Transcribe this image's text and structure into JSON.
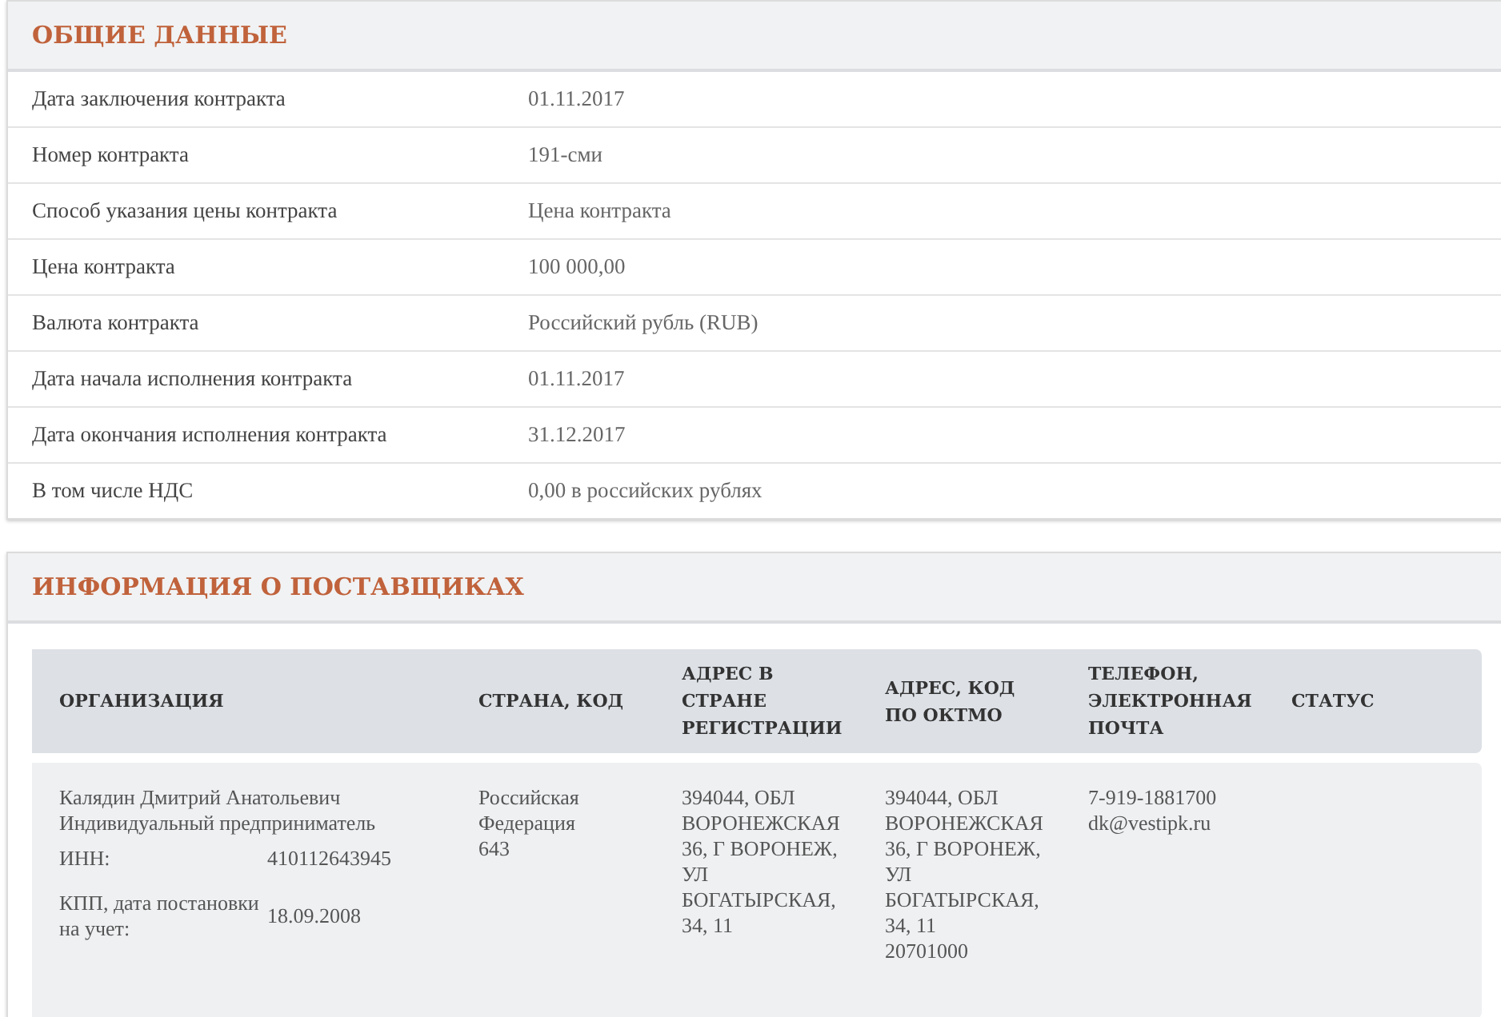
{
  "general": {
    "title": "ОБЩИЕ ДАННЫЕ",
    "rows": [
      {
        "label": "Дата заключения контракта",
        "value": "01.11.2017"
      },
      {
        "label": "Номер контракта",
        "value": "191-сми"
      },
      {
        "label": "Способ указания цены контракта",
        "value": "Цена контракта"
      },
      {
        "label": "Цена контракта",
        "value": "100 000,00"
      },
      {
        "label": "Валюта контракта",
        "value": "Российский рубль (RUB)"
      },
      {
        "label": "Дата начала исполнения контракта",
        "value": "01.11.2017"
      },
      {
        "label": "Дата окончания исполнения контракта",
        "value": "31.12.2017"
      },
      {
        "label": "В том числе НДС",
        "value": "0,00 в российских рублях"
      }
    ]
  },
  "suppliers": {
    "title": "ИНФОРМАЦИЯ О ПОСТАВЩИКАХ",
    "columns": [
      "ОРГАНИЗАЦИЯ",
      "СТРАНА, КОД",
      "АДРЕС В СТРАНЕ РЕГИСТРАЦИИ",
      "АДРЕС, КОД ПО ОКТМО",
      "ТЕЛЕФОН, ЭЛЕКТРОННАЯ ПОЧТА",
      "СТАТУС"
    ],
    "rows": [
      {
        "name": "Калядин Дмитрий Анатольевич",
        "type": "Индивидуальный предприниматель",
        "details": [
          {
            "label": "ИНН:",
            "value": "410112643945"
          },
          {
            "label": "КПП, дата постановки на учет:",
            "value": "18.09.2008"
          }
        ],
        "country": [
          "Российская Федерация",
          "643"
        ],
        "reg_address": "394044, ОБЛ ВОРОНЕЖСКАЯ 36, Г ВОРОНЕЖ, УЛ БОГАТЫРСКАЯ, 34, 11",
        "oktmo_address": "394044, ОБЛ ВОРОНЕЖСКАЯ 36, Г ВОРОНЕЖ, УЛ БОГАТЫРСКАЯ, 34, 11",
        "oktmo": "20701000",
        "phone": "7-919-1881700",
        "email": "dk@vestipk.ru"
      }
    ]
  }
}
